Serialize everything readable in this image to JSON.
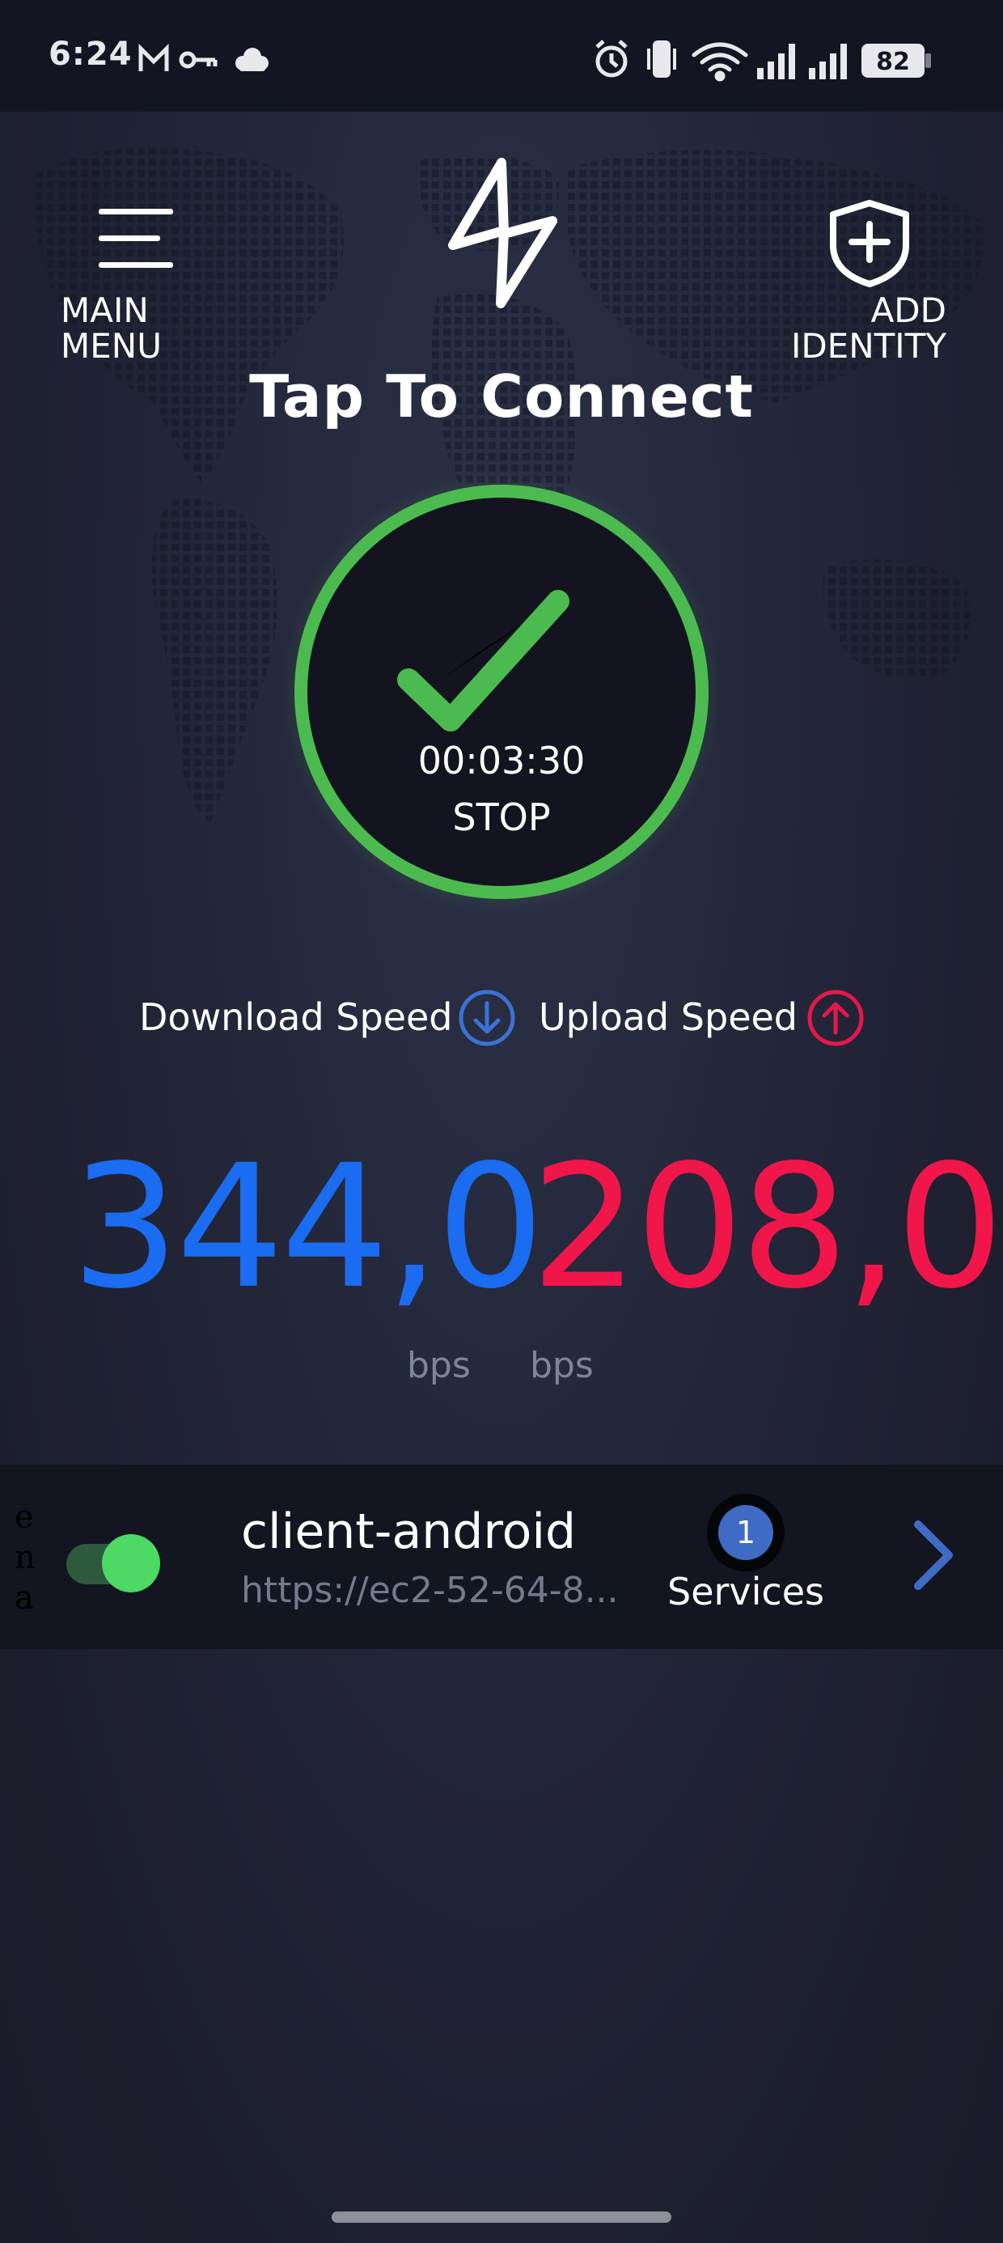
{
  "status_bar": {
    "time": "6:24",
    "left_icons": [
      "gmail-icon",
      "vpn-key-icon",
      "cloud-icon"
    ],
    "right_icons": [
      "alarm-icon",
      "vibrate-icon",
      "wifi-icon",
      "signal-icon",
      "signal-icon"
    ],
    "battery": "82"
  },
  "header": {
    "menu_label": "MAIN\nMENU",
    "logo_icon": "lightning-bolt-logo",
    "identity_label": "ADD\nIDENTITY",
    "title": "Tap To Connect"
  },
  "connection": {
    "timer": "00:03:30",
    "stop_label": "STOP",
    "ring_color": "#4cbb4f"
  },
  "speed": {
    "download_label": "Download Speed",
    "upload_label": "Upload Speed",
    "download_value": "344,0",
    "upload_value": "208,0",
    "download_unit": "bps",
    "upload_unit": "bps",
    "download_color": "#1a6cf0",
    "upload_color": "#f0164a"
  },
  "identity": {
    "side_letters": "e\nn\na",
    "enabled": true,
    "name": "client-android",
    "url": "https://ec2-52-64-8...",
    "services_count": "1",
    "services_label": "Services"
  }
}
